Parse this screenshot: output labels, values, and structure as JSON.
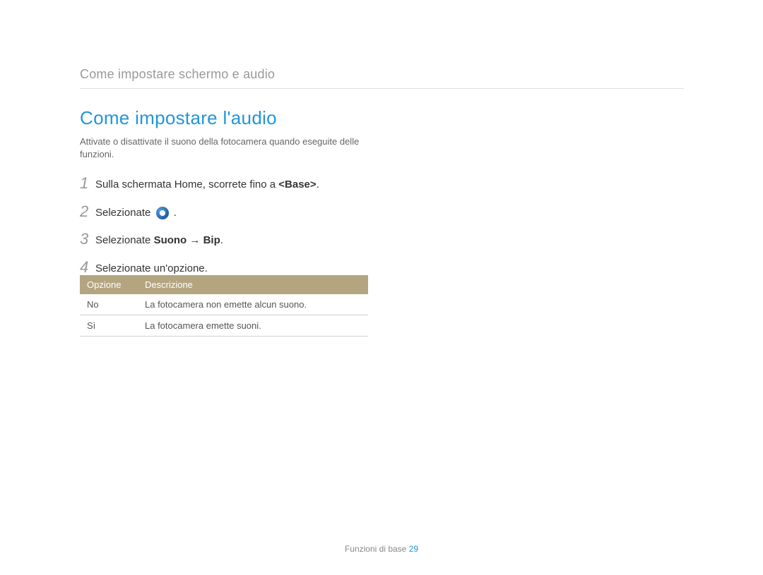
{
  "header_title": "Come impostare schermo e audio",
  "main_title": "Come impostare l'audio",
  "intro": "Attivate o disattivate il suono della fotocamera quando eseguite delle funzioni.",
  "steps": {
    "s1_num": "1",
    "s1_prefix": "Sulla schermata Home, scorrete fino a ",
    "s1_bold": "<Base>",
    "s1_suffix": ".",
    "s2_num": "2",
    "s2_prefix": "Selezionate ",
    "s2_suffix": " .",
    "s3_num": "3",
    "s3_prefix": "Selezionate ",
    "s3_bold1": "Suono",
    "s3_arrow": " → ",
    "s3_bold2": "Bip",
    "s3_suffix": ".",
    "s4_num": "4",
    "s4_text": "Selezionate un'opzione."
  },
  "table": {
    "header_option": "Opzione",
    "header_desc": "Descrizione",
    "row1_opt": "No",
    "row1_desc": "La fotocamera non emette alcun suono.",
    "row2_opt": "Sì",
    "row2_desc": "La fotocamera emette suoni."
  },
  "footer": {
    "label": "Funzioni di base  ",
    "page": "29"
  }
}
